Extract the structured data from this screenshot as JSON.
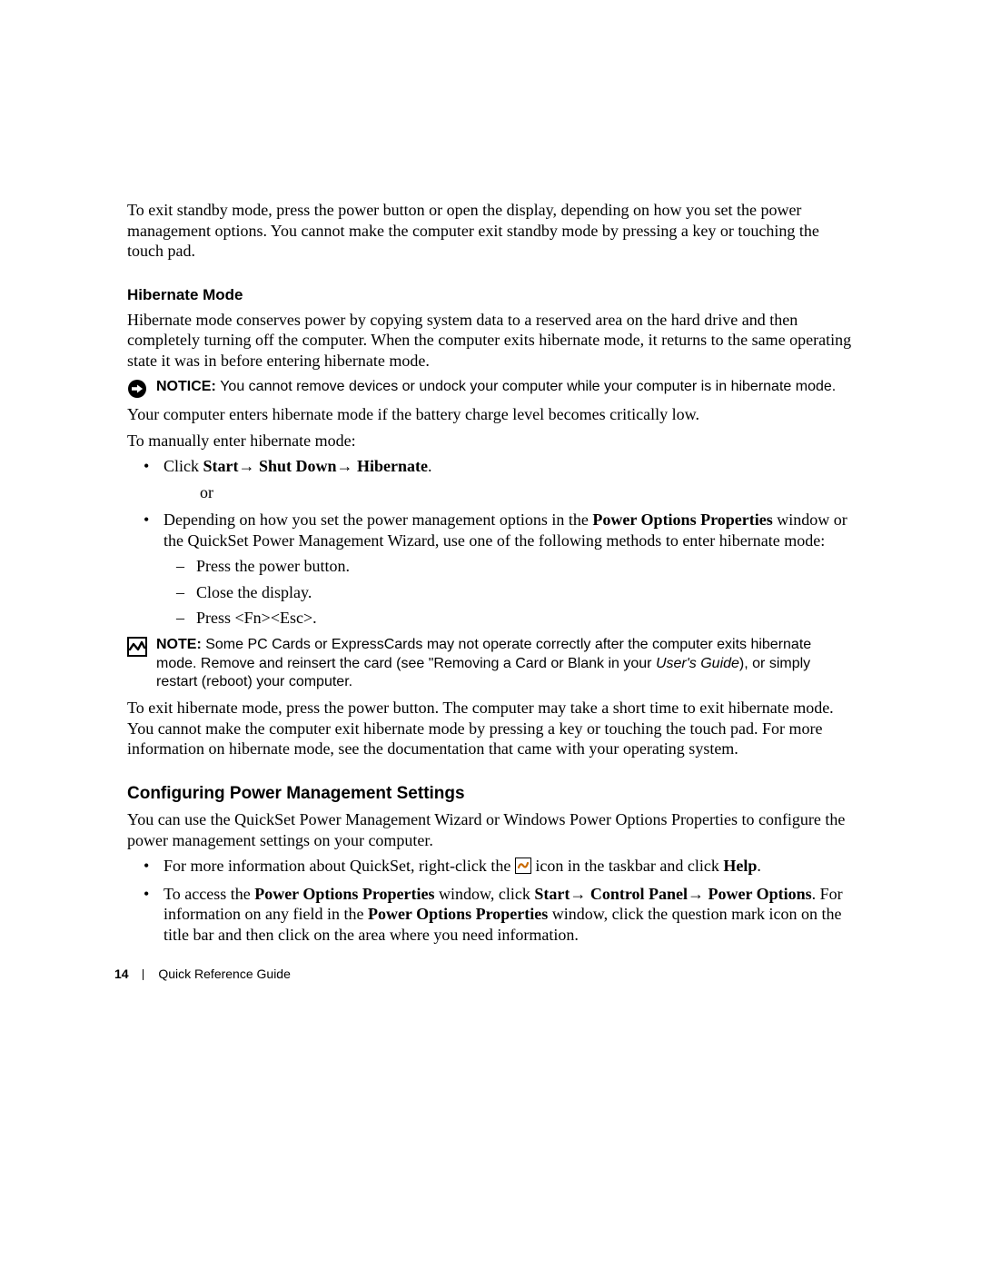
{
  "intro_exit_standby": "To exit standby mode, press the power button or open the display, depending on how you set the power management options. You cannot make the computer exit standby mode by pressing a key or touching the touch pad.",
  "hibernate": {
    "heading": "Hibernate Mode",
    "desc": "Hibernate mode conserves power by copying system data to a reserved area on the hard drive and then completely turning off the computer. When the computer exits hibernate mode, it returns to the same operating state it was in before entering hibernate mode.",
    "notice_lead": "NOTICE: ",
    "notice_text": "You cannot remove devices or undock your computer while your computer is in hibernate mode.",
    "auto_enter": "Your computer enters hibernate mode if the battery charge level becomes critically low.",
    "manual_intro": "To manually enter hibernate mode:",
    "click_prefix": "Click ",
    "click_start": "Start",
    "click_shutdown": " Shut Down",
    "click_hibernate": " Hibernate",
    "period": ".",
    "or": "or",
    "depending_prefix": "Depending on how you set the power management options in the ",
    "pop_props": "Power Options Properties",
    "depending_suffix": " window or the QuickSet Power Management Wizard, use one of the following methods to enter hibernate mode:",
    "dash1": "Press the power button.",
    "dash2": "Close the display.",
    "dash3": "Press <Fn><Esc>.",
    "note_lead": "NOTE: ",
    "note_a": "Some PC Cards or ExpressCards may not operate correctly after the computer exits hibernate mode. Remove and reinsert the card (see \"Removing a Card or Blank in your ",
    "note_italic": "User's Guide",
    "note_b": "), or simply restart (reboot) your computer.",
    "exit_text": "To exit hibernate mode, press the power button. The computer may take a short time to exit hibernate mode. You cannot make the computer exit hibernate mode by pressing a key or touching the touch pad. For more information on hibernate mode, see the documentation that came with your operating system."
  },
  "config": {
    "heading": "Configuring Power Management Settings",
    "intro": "You can use the QuickSet Power Management Wizard or Windows Power Options Properties to configure the power management settings on your computer.",
    "b1_a": "For more information about QuickSet, right-click the ",
    "b1_b": " icon in the taskbar and click ",
    "b1_help": "Help",
    "b2_a": "To access the ",
    "b2_pop": "Power Options Properties",
    "b2_b": " window, click ",
    "b2_start": "Start",
    "b2_cp": " Control Panel",
    "b2_po": " Power Options",
    "b2_c": ". For information on any field in the ",
    "b2_pop2": "Power Options Properties",
    "b2_d": " window, click the question mark icon on the title bar and then click on the area where you need information."
  },
  "footer": {
    "page": "14",
    "title": "Quick Reference Guide"
  },
  "arrow": "→"
}
